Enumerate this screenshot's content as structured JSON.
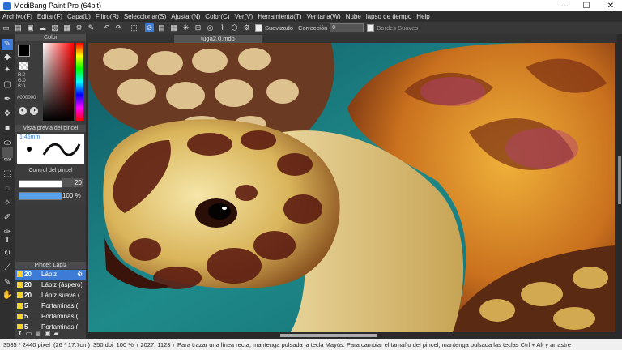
{
  "window": {
    "title": "MediBang Paint Pro (64bit)",
    "controls": {
      "minimize": "—",
      "maximize": "☐",
      "close": "✕"
    }
  },
  "menu": [
    "Archivo(F)",
    "Editar(F)",
    "Capa(L)",
    "Filtro(R)",
    "Seleccionar(S)",
    "Ajustar(N)",
    "Color(C)",
    "Ver(V)",
    "Herramienta(T)",
    "Ventana(W)",
    "Nube",
    "lapso de tiempo",
    "Help"
  ],
  "toolbar": {
    "smoothing_label": "Suavizado",
    "correction_label": "Corrección",
    "correction_value": "0",
    "soft_edges_label": "Bordes Suaves"
  },
  "color_panel": {
    "title": "Color",
    "values": [
      "R:0",
      "G:0",
      "B:0"
    ],
    "hex": "#000000",
    "accent": "#3d7bd6"
  },
  "brush_preview": {
    "title": "Vista previa del pincel",
    "size": "1.45mm"
  },
  "brush_control": {
    "title": "Control del pincel",
    "size_value": "20",
    "opacity_value": "100 %"
  },
  "brush_list": {
    "title": "Pincel: Lápiz",
    "items": [
      {
        "size": "20",
        "name": "Lápiz"
      },
      {
        "size": "20",
        "name": "Lápiz (áspero)"
      },
      {
        "size": "20",
        "name": "Lápiz suave ("
      },
      {
        "size": "5",
        "name": "Portaminas ("
      },
      {
        "size": "5",
        "name": "Portaminas ("
      },
      {
        "size": "5",
        "name": "Portaminas ("
      }
    ]
  },
  "document": {
    "tab": "tuga2.0.mdp"
  },
  "status": {
    "dimensions": "3585 * 2440 pixel",
    "physical": "(26 * 17.7cm)",
    "dpi": "350 dpi",
    "zoom": "100 %",
    "coords": "( 2027, 1123 )",
    "hint": "Para trazar una línea recta, mantenga pulsada la tecla Mayús. Para cambiar el tamaño del pincel, mantenga pulsada las teclas Ctrl + Alt y arrastre"
  }
}
